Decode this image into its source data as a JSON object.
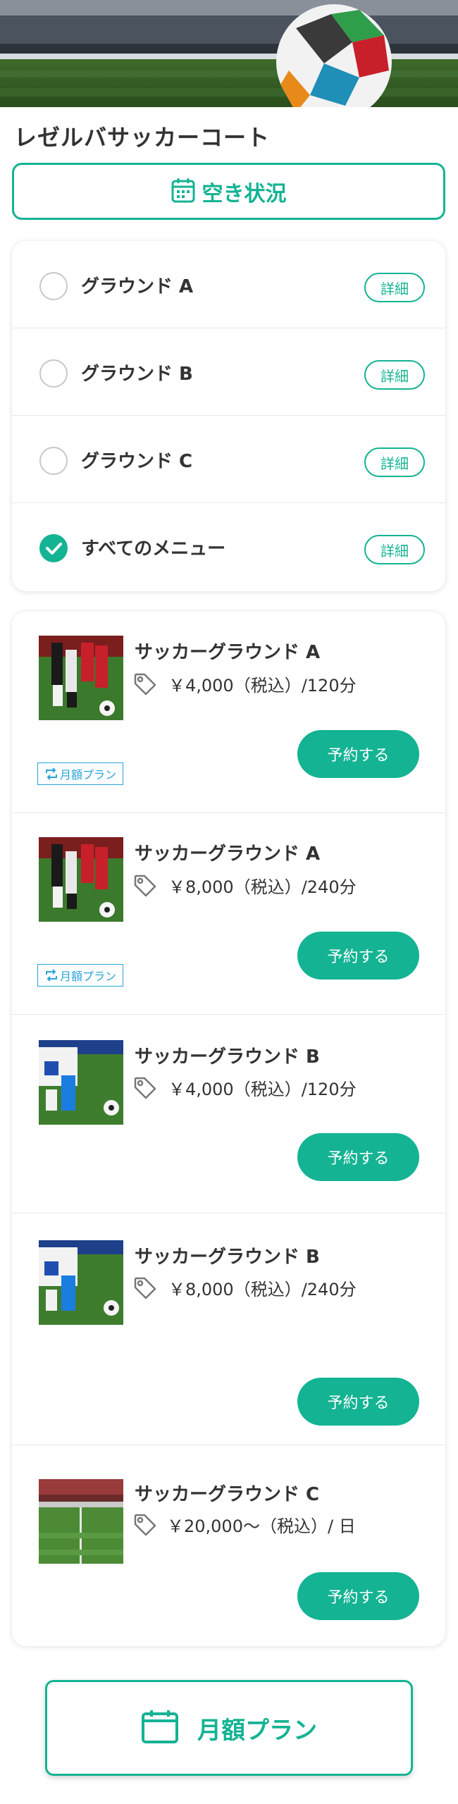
{
  "facility": {
    "name": "レゼルバサッカーコート"
  },
  "availability": {
    "label": "空き状況",
    "icon": "calendar-icon"
  },
  "filters": [
    {
      "label": "グラウンド A",
      "checked": false,
      "detail_label": "詳細"
    },
    {
      "label": "グラウンド B",
      "checked": false,
      "detail_label": "詳細"
    },
    {
      "label": "グラウンド C",
      "checked": false,
      "detail_label": "詳細"
    },
    {
      "label": "すべてのメニュー",
      "checked": true,
      "detail_label": "詳細"
    }
  ],
  "plans": [
    {
      "name": "サッカーグラウンド A",
      "price": "￥4,000（税込）/120分",
      "reserve_label": "予約する",
      "badge": "月額プラン"
    },
    {
      "name": "サッカーグラウンド A",
      "price": "￥8,000（税込）/240分",
      "reserve_label": "予約する",
      "badge": "月額プラン"
    },
    {
      "name": "サッカーグラウンド B",
      "price": "￥4,000（税込）/120分",
      "reserve_label": "予約する"
    },
    {
      "name": "サッカーグラウンド B",
      "price": "￥8,000（税込）/240分",
      "reserve_label": "予約する"
    },
    {
      "name": "サッカーグラウンド C",
      "price": "￥20,000～（税込）/ 日",
      "reserve_label": "予約する"
    }
  ],
  "monthly_plan": {
    "label": "月額プラン",
    "icon": "calendar-icon"
  },
  "colors": {
    "accent": "#14b393",
    "badge": "#2aa3d8",
    "text": "#333333"
  }
}
